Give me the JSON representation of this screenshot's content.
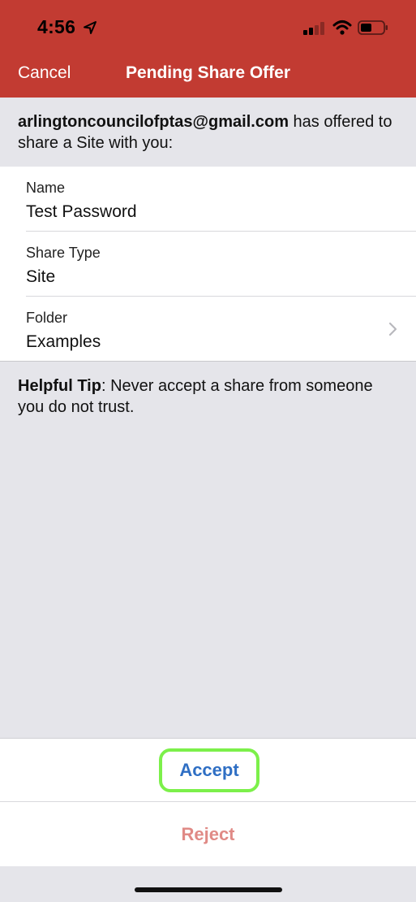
{
  "status_bar": {
    "time": "4:56",
    "icons": [
      "location-arrow-icon",
      "cellular-signal-icon",
      "wifi-icon",
      "battery-icon"
    ]
  },
  "nav": {
    "cancel_label": "Cancel",
    "title": "Pending Share Offer"
  },
  "offer": {
    "sender": "arlingtoncouncilofptas@gmail.com",
    "message": " has offered to share a Site with you:"
  },
  "details": [
    {
      "label": "Name",
      "value": "Test Password",
      "has_chevron": false
    },
    {
      "label": "Share Type",
      "value": "Site",
      "has_chevron": false
    },
    {
      "label": "Folder",
      "value": "Examples",
      "has_chevron": true
    }
  ],
  "tip": {
    "heading": "Helpful Tip",
    "text": ": Never accept a share from someone you do not trust."
  },
  "actions": {
    "accept_label": "Accept",
    "reject_label": "Reject"
  },
  "colors": {
    "header_bg": "#c23b32",
    "page_bg": "#e5e5ea",
    "accept_text": "#2f6fc4",
    "accept_highlight": "#7cf04a",
    "reject_text": "#e08a86"
  }
}
